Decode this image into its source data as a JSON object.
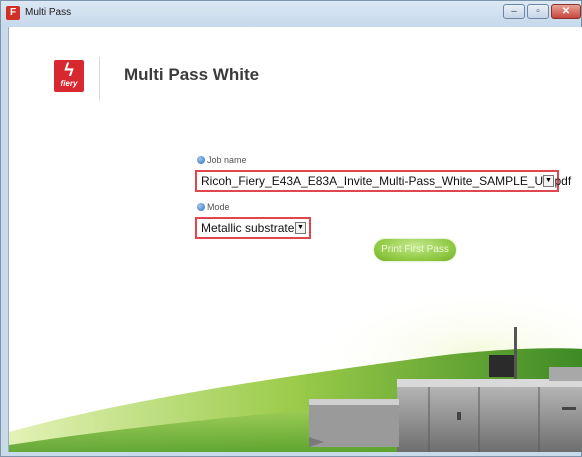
{
  "window": {
    "title": "Multi Pass",
    "controls": [
      "minimize",
      "maximize",
      "close"
    ]
  },
  "header": {
    "logo_text": "fiery",
    "app_title": "Multi Pass White"
  },
  "form": {
    "job_name": {
      "label": "Job name",
      "value": "Ricoh_Fiery_E43A_E83A_Invite_Multi-Pass_White_SAMPLE_US.pdf"
    },
    "mode": {
      "label": "Mode",
      "value": "Metallic substrate"
    },
    "print_button_label": "Print First Pass"
  },
  "colors": {
    "accent_red": "#e0474c",
    "button_green": "#8cc63f",
    "brand_red": "#d6282e"
  },
  "icons": {
    "select_arrow": "chevron-down-icon",
    "label_marker": "info-dot-icon"
  }
}
